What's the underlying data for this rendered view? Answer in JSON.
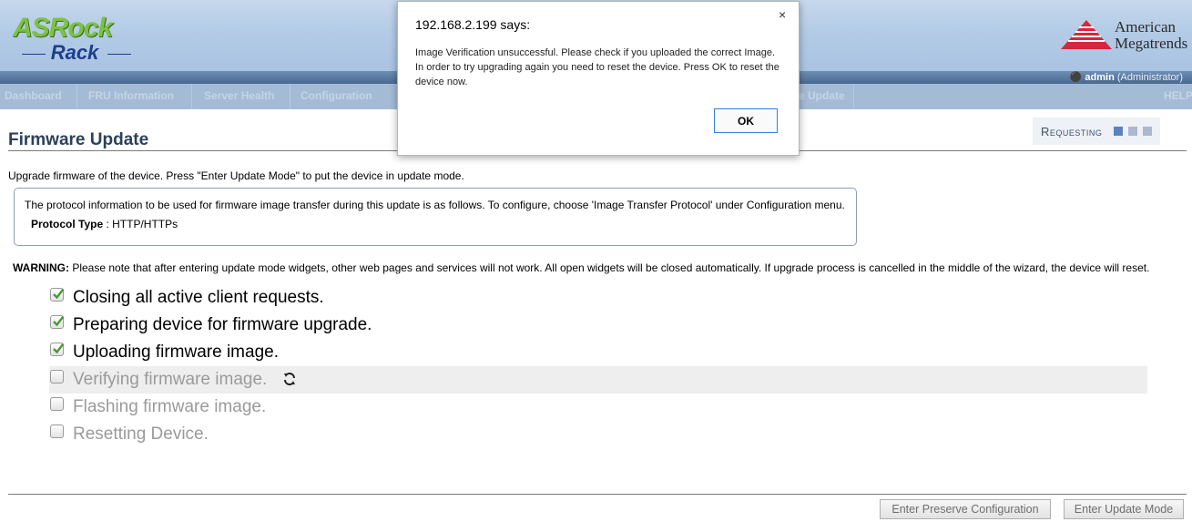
{
  "header": {
    "logo_main": "ASRock",
    "logo_sub": "Rack",
    "vendor_line1": "American",
    "vendor_line2": "Megatrends",
    "user_name": "admin",
    "user_role": "(Administrator)"
  },
  "nav": {
    "items": [
      "Dashboard",
      "FRU Information",
      "Server Health",
      "Configuration",
      "e Update",
      "HELP"
    ]
  },
  "status": {
    "requesting_label": "Requesting",
    "indicator_colors": [
      "#5a82c0",
      "#aab9d0",
      "#aab9d0"
    ]
  },
  "page": {
    "title": "Firmware Update",
    "description": "Upgrade firmware of the device. Press \"Enter Update Mode\" to put the device in update mode.",
    "protocol_info": "The protocol information to be used for firmware image transfer during this update is as follows. To configure, choose 'Image Transfer Protocol' under Configuration menu.",
    "protocol_type_label": "Protocol Type",
    "protocol_type_value": ": HTTP/HTTPs",
    "warning_label": "WARNING:",
    "warning_text": " Please note that after entering update mode widgets, other web pages and services will not work. All open widgets will be closed automatically. If upgrade process is cancelled in the middle of the wizard, the device will reset."
  },
  "steps": [
    {
      "label": "Closing all active client requests.",
      "checked": true
    },
    {
      "label": "Preparing device for firmware upgrade.",
      "checked": true
    },
    {
      "label": "Uploading firmware image.",
      "checked": true
    },
    {
      "label": "Verifying firmware image.",
      "checked": false,
      "in_progress": true
    },
    {
      "label": "Flashing firmware image.",
      "checked": false
    },
    {
      "label": "Resetting Device.",
      "checked": false
    }
  ],
  "buttons": {
    "preserve_config": "Enter Preserve Configuration",
    "update_mode": "Enter Update Mode"
  },
  "dialog": {
    "title": "192.168.2.199 says:",
    "close": "×",
    "message": "Image Verification unsuccessful. Please check if you uploaded the correct Image. In order to try upgrading again you need to reset the device. Press OK to reset the device now.",
    "ok_label": "OK"
  },
  "colors": {
    "header_bg": "#b3cbe6",
    "nav_bg": "#a4bbd6",
    "title_color": "#2c4159",
    "check_green": "#4a9a34",
    "dialog_button_border": "#3c7fd8"
  }
}
